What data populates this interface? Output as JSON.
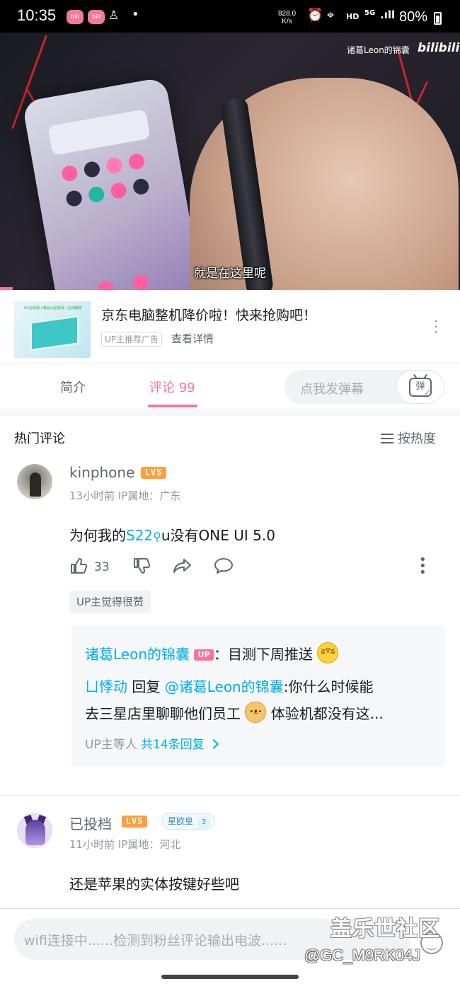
{
  "status_bar": {
    "time": "10:35",
    "app_icons": [
      "bilibili-icon",
      "bilibili-icon",
      "person-icon"
    ],
    "notification_dot": "•",
    "net_speed_value": "828.0",
    "net_speed_unit": "K/s",
    "alarm_icon": "⏰",
    "location_icon": "⌖",
    "hd_label": "HD",
    "network_label": "5G",
    "signal_icon": ".ıll",
    "battery": "80%"
  },
  "video": {
    "watermark": "诸葛Leon的锦囊",
    "site_logo": "bilibili",
    "subtitle": "就是在这里呢",
    "progress_color": "#fb7299"
  },
  "ad": {
    "thumb_text": "5G全网通 | 畅玩大型游戏 | 在线教育",
    "title": "京东电脑整机降价啦！快来抢购吧！",
    "tag": "UP主推荐广告",
    "detail_link": "查看详情",
    "more_icon": "⋮"
  },
  "tabs": {
    "intro": "简介",
    "comments": "评论 99",
    "danmaku_placeholder": "点我发弹幕",
    "danmaku_button": "弹",
    "danmaku_check": "✓",
    "accent": "#fb7299"
  },
  "comments_section": {
    "title": "热门评论",
    "sort_label": "按热度"
  },
  "comments": [
    {
      "username": "kinphone",
      "level": "LV5",
      "meta": "13小时前  IP属地：广东",
      "text_before": "为何我的",
      "keyword": "S22",
      "keyword_icon": "⚲",
      "text_after": "u没有ONE UI 5.0",
      "likes": "33",
      "like_icon": "👍",
      "dislike_icon": "👎",
      "share_icon": "↪",
      "reply_icon": "💬",
      "more_icon": "⋮",
      "up_badge": "UP主觉得很赞",
      "replies": [
        {
          "name": "诸葛Leon的锦囊",
          "up_tag": "UP",
          "text": "：目测下周推送"
        },
        {
          "name": "ㄩ悸动",
          "reply_word": " 回复 ",
          "mention": "@诸葛Leon的锦囊",
          "text_a": ":你什么时候能",
          "text_b": "去三星店里聊聊他们员工",
          "text_c": "体验机都没有这..."
        }
      ],
      "replies_more_prefix": "UP主等人 ",
      "replies_more_count": "共14条回复"
    },
    {
      "username": "已投档",
      "level": "LV5",
      "badge_label": "星欧皇",
      "badge_num": "3",
      "meta": "11小时前  IP属地：河北",
      "text": "还是苹果的实体按键好些吧"
    }
  ],
  "bottom": {
    "input_placeholder": "wifi连接中......检测到粉丝评论输出电波......",
    "emoji_icon": "emoji-icon",
    "forum_watermark": "盖乐世社区",
    "user_watermark": "@GC_M9RK04J"
  }
}
